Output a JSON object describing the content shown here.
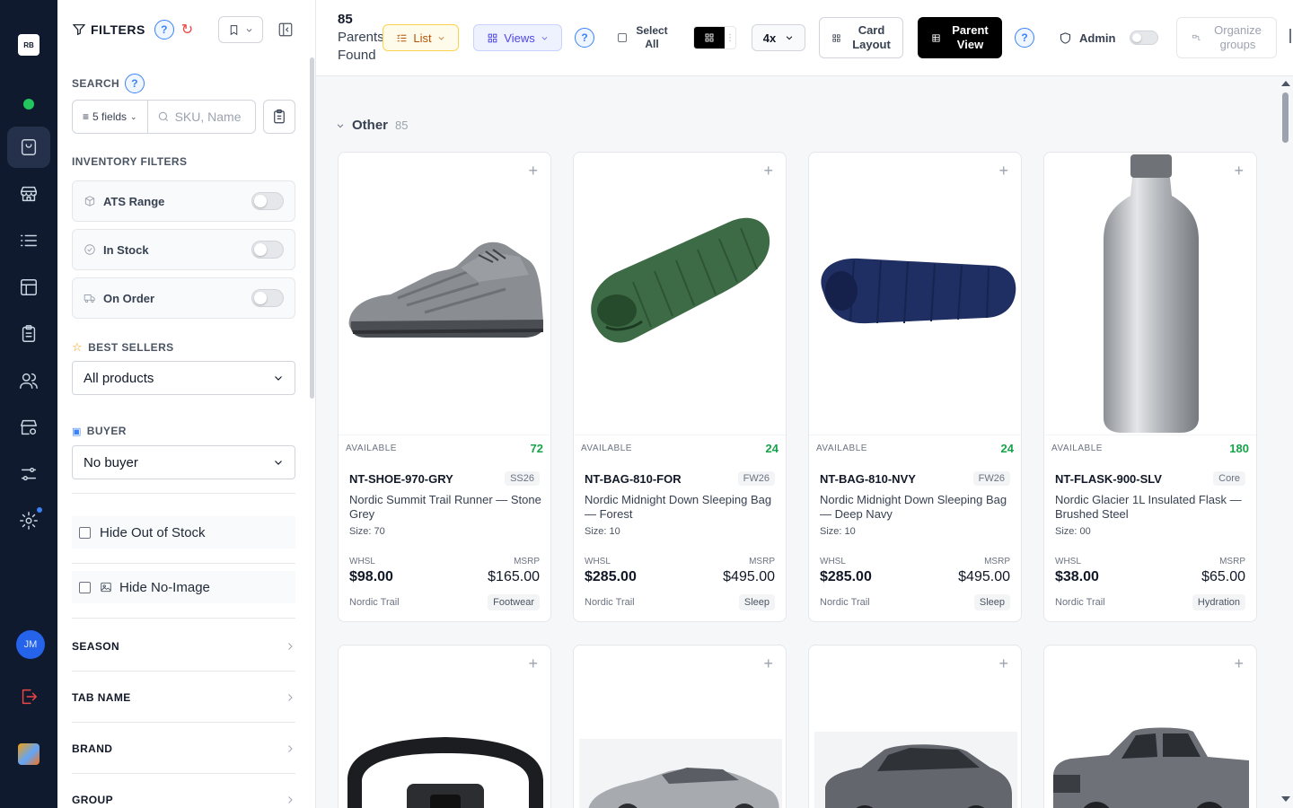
{
  "rail": {
    "logo": "RB",
    "avatar_initials": "JM"
  },
  "sidebar": {
    "title": "FILTERS",
    "help": "?",
    "reset": "↻",
    "search_label": "SEARCH",
    "fields_button": "5 fields",
    "search_placeholder": "SKU, Name",
    "inventory_label": "INVENTORY FILTERS",
    "toggles": [
      {
        "label": "ATS Range",
        "on": false
      },
      {
        "label": "In Stock",
        "on": false
      },
      {
        "label": "On Order",
        "on": false
      }
    ],
    "best_sellers_label": "BEST SELLERS",
    "best_sellers_value": "All products",
    "buyer_label": "BUYER",
    "buyer_value": "No buyer",
    "hide_out_of_stock": "Hide Out of Stock",
    "hide_no_image": "Hide No-Image",
    "sections": [
      "SEASON",
      "TAB NAME",
      "BRAND",
      "GROUP"
    ]
  },
  "toolbar": {
    "count": "85",
    "count_line2": "Parents",
    "count_line3": "Found",
    "list": "List",
    "views": "Views",
    "help": "?",
    "select_all_line1": "Select",
    "select_all_line2": "All",
    "zoom": "4x",
    "card_layout_line1": "Card",
    "card_layout_line2": "Layout",
    "parent_view_line1": "Parent",
    "parent_view_line2": "View",
    "admin": "Admin",
    "organize_line1": "Organize",
    "organize_line2": "groups"
  },
  "group": {
    "name": "Other",
    "count": "85"
  },
  "available_label": "AVAILABLE",
  "whsl_label": "WHSL",
  "msrp_label": "MSRP",
  "size_prefix": "Size:",
  "products": [
    {
      "sku": "NT-SHOE-970-GRY",
      "season": "SS26",
      "name": "Nordic Summit Trail Runner — Stone Grey",
      "size": "70",
      "available": "72",
      "whsl": "$98.00",
      "msrp": "$165.00",
      "brand": "Nordic Trail",
      "category": "Footwear",
      "image": "shoe-image"
    },
    {
      "sku": "NT-BAG-810-FOR",
      "season": "FW26",
      "name": "Nordic Midnight Down Sleeping Bag — Forest",
      "size": "10",
      "available": "24",
      "whsl": "$285.00",
      "msrp": "$495.00",
      "brand": "Nordic Trail",
      "category": "Sleep",
      "image": "sleeping-bag-green-image"
    },
    {
      "sku": "NT-BAG-810-NVY",
      "season": "FW26",
      "name": "Nordic Midnight Down Sleeping Bag — Deep Navy",
      "size": "10",
      "available": "24",
      "whsl": "$285.00",
      "msrp": "$495.00",
      "brand": "Nordic Trail",
      "category": "Sleep",
      "image": "sleeping-bag-navy-image"
    },
    {
      "sku": "NT-FLASK-900-SLV",
      "season": "Core",
      "name": "Nordic Glacier 1L Insulated Flask — Brushed Steel",
      "size": "00",
      "available": "180",
      "whsl": "$38.00",
      "msrp": "$65.00",
      "brand": "Nordic Trail",
      "category": "Hydration",
      "image": "flask-image"
    }
  ],
  "colors": {
    "rail": "#101a2e",
    "accent_blue": "#3b82f6",
    "available_green": "#16a34a",
    "list_amber": "#b45309",
    "views_indigo": "#4f46e5"
  }
}
